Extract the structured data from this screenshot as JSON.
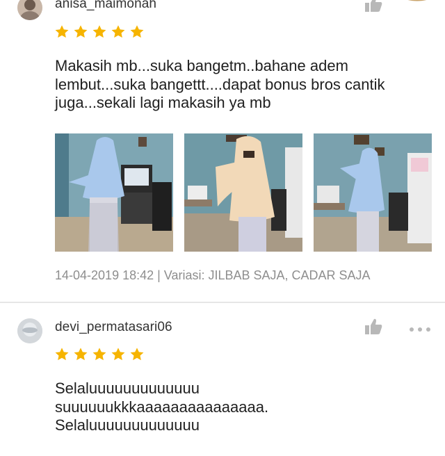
{
  "reviews": [
    {
      "username": "anisa_maimonah",
      "rating": 5,
      "comment": "Makasih mb...suka bangetm..bahane adem\nlembut...suka bangettt....dapat bonus bros cantik\njuga...sekali lagi makasih ya mb",
      "photos": [
        {
          "icon": "photo-thumbnail",
          "hijab_color": "#a9c8ec"
        },
        {
          "icon": "photo-thumbnail",
          "hijab_color": "#f2d9b8"
        },
        {
          "icon": "photo-thumbnail",
          "hijab_color": "#a9c8ec"
        }
      ],
      "meta": "14-04-2019 18:42 | Variasi: JILBAB SAJA, CADAR SAJA"
    },
    {
      "username": "devi_permatasari06",
      "rating": 5,
      "comment": "Selaluuuuuuuuuuuuu\nsuuuuuukkkaaaaaaaaaaaaaaa.\nSelaluuuuuuuuuuuuu"
    }
  ],
  "colors": {
    "star": "#f6b400",
    "like_icon": "#b8b8b8",
    "meta_text": "#8e8e8e",
    "divider": "#e6e6e6"
  },
  "icons": [
    "avatar",
    "thumbs-up-icon",
    "more-options-icon",
    "star-icon"
  ]
}
